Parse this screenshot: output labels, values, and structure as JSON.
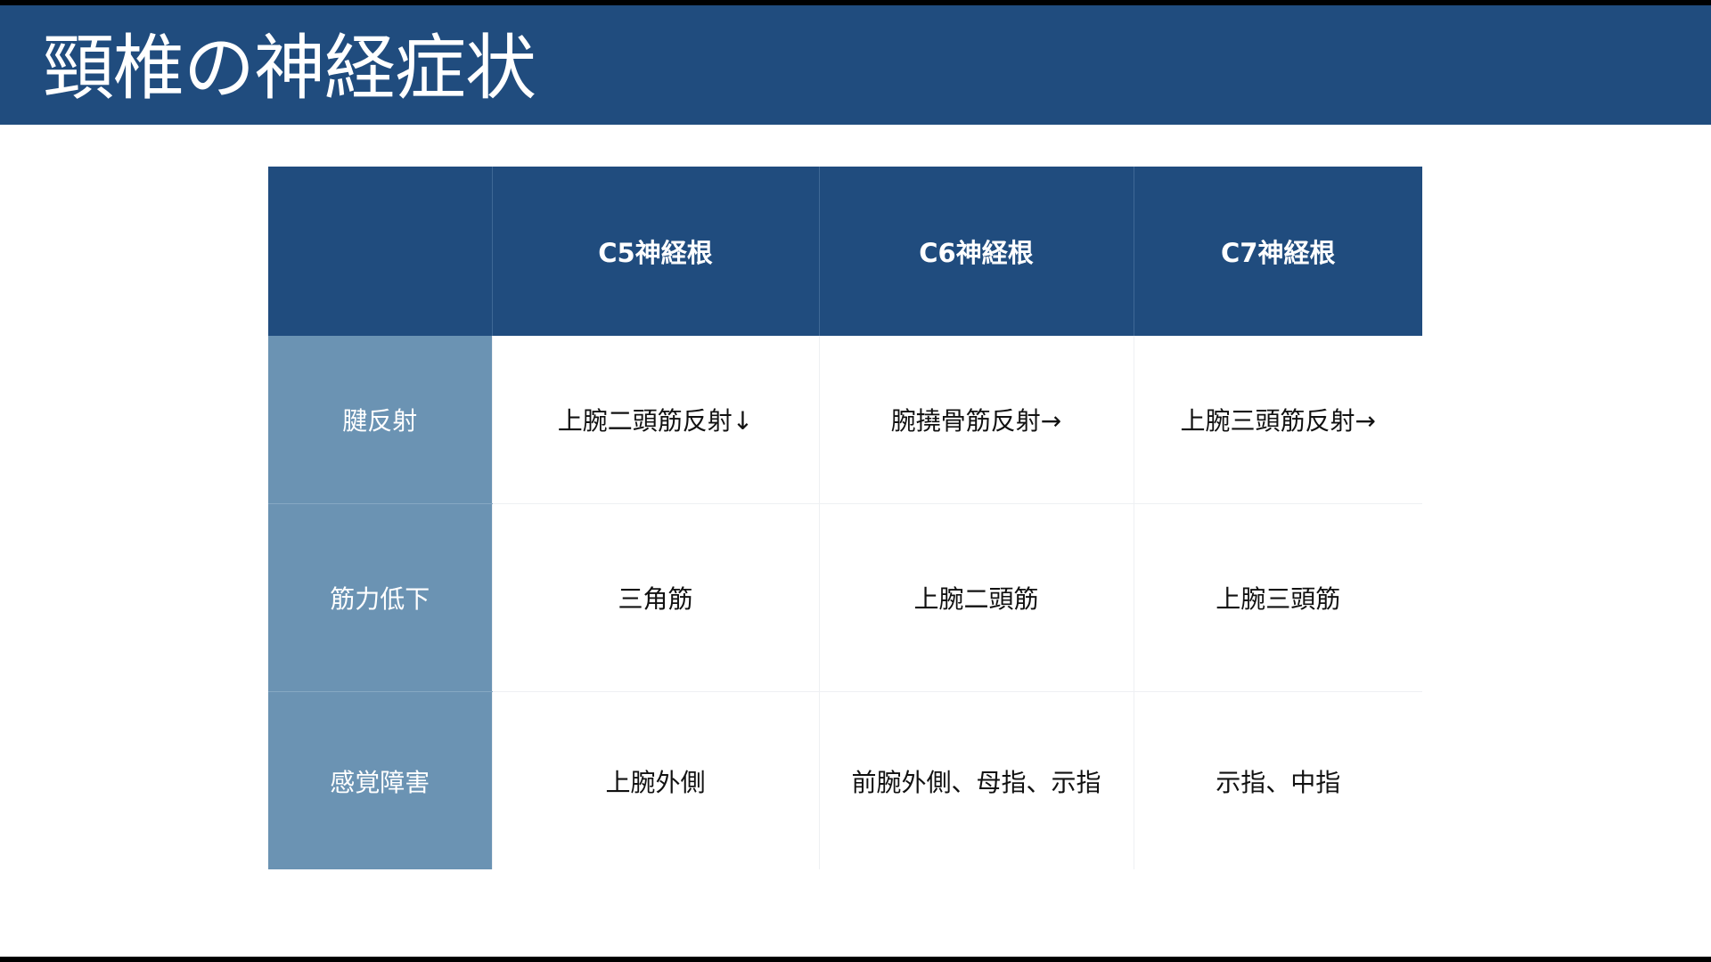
{
  "title": "頸椎の神経症状",
  "table": {
    "columns": [
      "",
      "C5神経根",
      "C6神経根",
      "C7神経根"
    ],
    "rows": [
      {
        "label": "腱反射",
        "cells": [
          "上腕二頭筋反射↓",
          "腕撓骨筋反射→",
          "上腕三頭筋反射→"
        ]
      },
      {
        "label": "筋力低下",
        "cells": [
          "三角筋",
          "上腕二頭筋",
          "上腕三頭筋"
        ]
      },
      {
        "label": "感覚障害",
        "cells": [
          "上腕外側",
          "前腕外側、母指、示指",
          "示指、中指"
        ]
      }
    ]
  },
  "colors": {
    "header": "#204c7e",
    "row_label": "#6b93b3",
    "cell": "#ffffff"
  }
}
